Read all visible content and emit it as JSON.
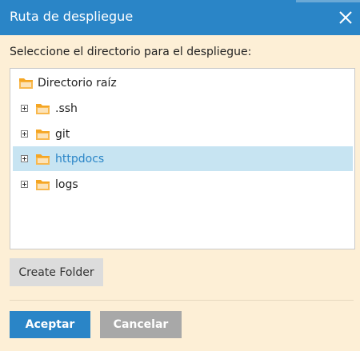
{
  "dialog": {
    "title": "Ruta de despliegue",
    "prompt": "Seleccione el directorio para el despliegue:"
  },
  "tree": {
    "root": {
      "label": "Directorio raíz",
      "icon": "folder-open-icon"
    },
    "children": [
      {
        "label": ".ssh",
        "icon": "folder-icon",
        "selected": false
      },
      {
        "label": "git",
        "icon": "folder-icon",
        "selected": false
      },
      {
        "label": "httpdocs",
        "icon": "folder-icon",
        "selected": true
      },
      {
        "label": "logs",
        "icon": "folder-icon",
        "selected": false
      }
    ]
  },
  "buttons": {
    "create_folder": "Create Folder",
    "accept": "Aceptar",
    "cancel": "Cancelar"
  },
  "colors": {
    "titlebar": "#2a85c7",
    "dialog_bg": "#fdefd6",
    "selection": "#c7e4f2",
    "folder": "#f5a623",
    "accept": "#2a85c7",
    "cancel": "#a8a8a8"
  }
}
